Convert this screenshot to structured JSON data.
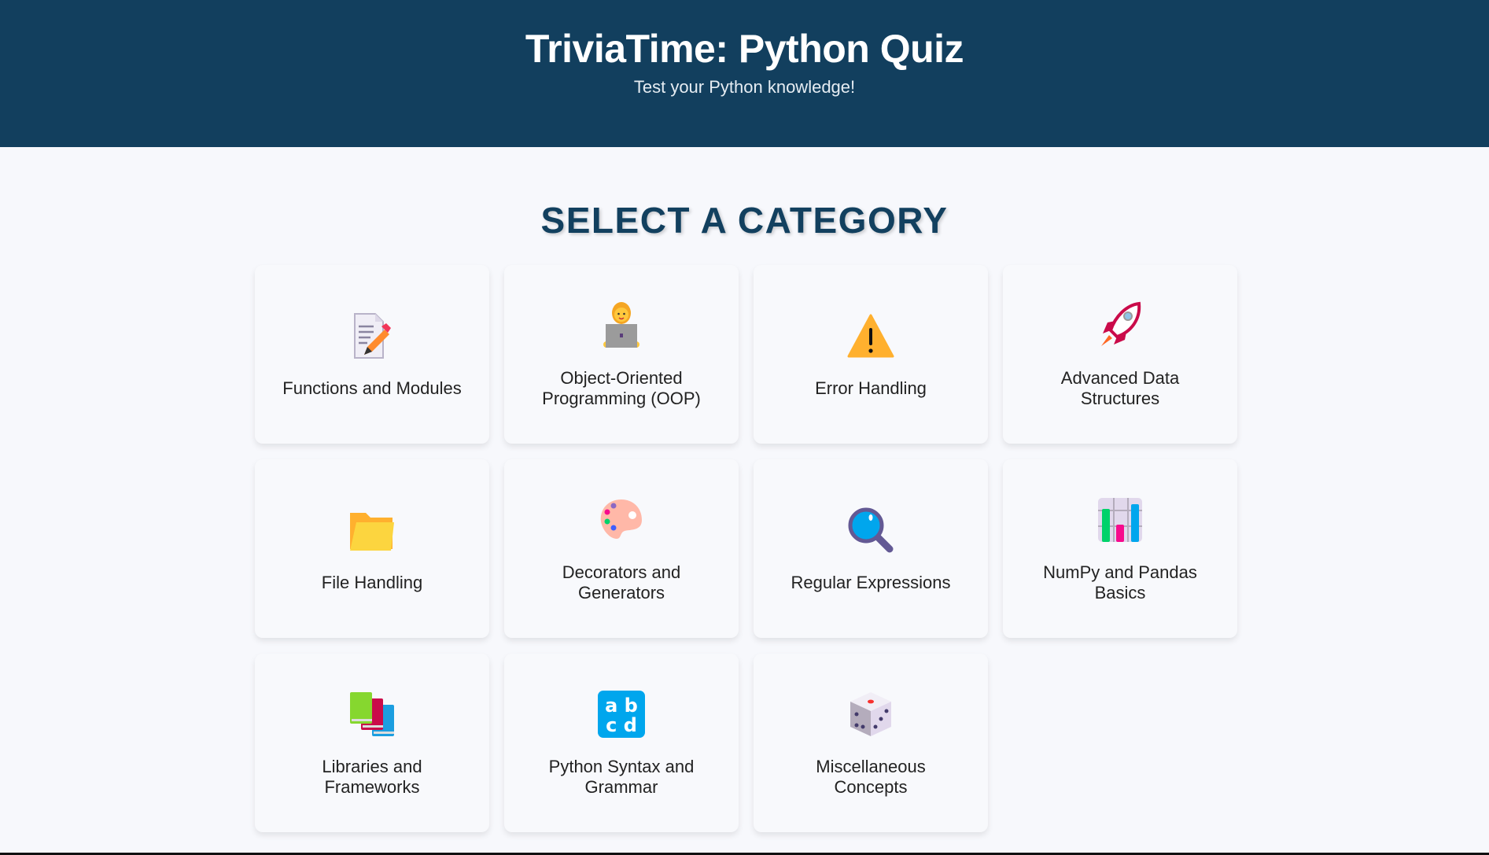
{
  "header": {
    "title": "TriviaTime: Python Quiz",
    "subtitle": "Test your Python knowledge!"
  },
  "section_title": "SELECT A CATEGORY",
  "categories": [
    {
      "label": "Functions and Modules",
      "icon": "memo-icon"
    },
    {
      "label": "Object-Oriented Programming (OOP)",
      "icon": "technologist-icon"
    },
    {
      "label": "Error Handling",
      "icon": "warning-icon"
    },
    {
      "label": "Advanced Data Structures",
      "icon": "rocket-icon"
    },
    {
      "label": "File Handling",
      "icon": "folder-icon"
    },
    {
      "label": "Decorators and Generators",
      "icon": "palette-icon"
    },
    {
      "label": "Regular Expressions",
      "icon": "magnifier-icon"
    },
    {
      "label": "NumPy and Pandas Basics",
      "icon": "bar-chart-icon"
    },
    {
      "label": "Libraries and Frameworks",
      "icon": "books-icon"
    },
    {
      "label": "Python Syntax and Grammar",
      "icon": "abcd-icon"
    },
    {
      "label": "Miscellaneous Concepts",
      "icon": "dice-icon"
    }
  ],
  "colors": {
    "header_bg": "#123f5e",
    "title": "#12405f"
  }
}
